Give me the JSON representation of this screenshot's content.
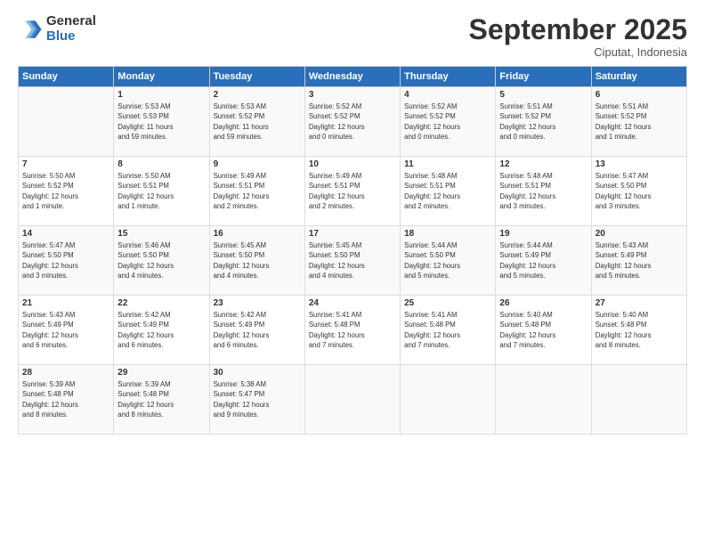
{
  "logo": {
    "general": "General",
    "blue": "Blue"
  },
  "title": "September 2025",
  "subtitle": "Ciputat, Indonesia",
  "headers": [
    "Sunday",
    "Monday",
    "Tuesday",
    "Wednesday",
    "Thursday",
    "Friday",
    "Saturday"
  ],
  "weeks": [
    [
      {
        "num": "",
        "info": ""
      },
      {
        "num": "1",
        "info": "Sunrise: 5:53 AM\nSunset: 5:53 PM\nDaylight: 11 hours\nand 59 minutes."
      },
      {
        "num": "2",
        "info": "Sunrise: 5:53 AM\nSunset: 5:52 PM\nDaylight: 11 hours\nand 59 minutes."
      },
      {
        "num": "3",
        "info": "Sunrise: 5:52 AM\nSunset: 5:52 PM\nDaylight: 12 hours\nand 0 minutes."
      },
      {
        "num": "4",
        "info": "Sunrise: 5:52 AM\nSunset: 5:52 PM\nDaylight: 12 hours\nand 0 minutes."
      },
      {
        "num": "5",
        "info": "Sunrise: 5:51 AM\nSunset: 5:52 PM\nDaylight: 12 hours\nand 0 minutes."
      },
      {
        "num": "6",
        "info": "Sunrise: 5:51 AM\nSunset: 5:52 PM\nDaylight: 12 hours\nand 1 minute."
      }
    ],
    [
      {
        "num": "7",
        "info": "Sunrise: 5:50 AM\nSunset: 5:52 PM\nDaylight: 12 hours\nand 1 minute."
      },
      {
        "num": "8",
        "info": "Sunrise: 5:50 AM\nSunset: 5:51 PM\nDaylight: 12 hours\nand 1 minute."
      },
      {
        "num": "9",
        "info": "Sunrise: 5:49 AM\nSunset: 5:51 PM\nDaylight: 12 hours\nand 2 minutes."
      },
      {
        "num": "10",
        "info": "Sunrise: 5:49 AM\nSunset: 5:51 PM\nDaylight: 12 hours\nand 2 minutes."
      },
      {
        "num": "11",
        "info": "Sunrise: 5:48 AM\nSunset: 5:51 PM\nDaylight: 12 hours\nand 2 minutes."
      },
      {
        "num": "12",
        "info": "Sunrise: 5:48 AM\nSunset: 5:51 PM\nDaylight: 12 hours\nand 3 minutes."
      },
      {
        "num": "13",
        "info": "Sunrise: 5:47 AM\nSunset: 5:50 PM\nDaylight: 12 hours\nand 3 minutes."
      }
    ],
    [
      {
        "num": "14",
        "info": "Sunrise: 5:47 AM\nSunset: 5:50 PM\nDaylight: 12 hours\nand 3 minutes."
      },
      {
        "num": "15",
        "info": "Sunrise: 5:46 AM\nSunset: 5:50 PM\nDaylight: 12 hours\nand 4 minutes."
      },
      {
        "num": "16",
        "info": "Sunrise: 5:45 AM\nSunset: 5:50 PM\nDaylight: 12 hours\nand 4 minutes."
      },
      {
        "num": "17",
        "info": "Sunrise: 5:45 AM\nSunset: 5:50 PM\nDaylight: 12 hours\nand 4 minutes."
      },
      {
        "num": "18",
        "info": "Sunrise: 5:44 AM\nSunset: 5:50 PM\nDaylight: 12 hours\nand 5 minutes."
      },
      {
        "num": "19",
        "info": "Sunrise: 5:44 AM\nSunset: 5:49 PM\nDaylight: 12 hours\nand 5 minutes."
      },
      {
        "num": "20",
        "info": "Sunrise: 5:43 AM\nSunset: 5:49 PM\nDaylight: 12 hours\nand 5 minutes."
      }
    ],
    [
      {
        "num": "21",
        "info": "Sunrise: 5:43 AM\nSunset: 5:49 PM\nDaylight: 12 hours\nand 6 minutes."
      },
      {
        "num": "22",
        "info": "Sunrise: 5:42 AM\nSunset: 5:49 PM\nDaylight: 12 hours\nand 6 minutes."
      },
      {
        "num": "23",
        "info": "Sunrise: 5:42 AM\nSunset: 5:49 PM\nDaylight: 12 hours\nand 6 minutes."
      },
      {
        "num": "24",
        "info": "Sunrise: 5:41 AM\nSunset: 5:48 PM\nDaylight: 12 hours\nand 7 minutes."
      },
      {
        "num": "25",
        "info": "Sunrise: 5:41 AM\nSunset: 5:48 PM\nDaylight: 12 hours\nand 7 minutes."
      },
      {
        "num": "26",
        "info": "Sunrise: 5:40 AM\nSunset: 5:48 PM\nDaylight: 12 hours\nand 7 minutes."
      },
      {
        "num": "27",
        "info": "Sunrise: 5:40 AM\nSunset: 5:48 PM\nDaylight: 12 hours\nand 8 minutes."
      }
    ],
    [
      {
        "num": "28",
        "info": "Sunrise: 5:39 AM\nSunset: 5:48 PM\nDaylight: 12 hours\nand 8 minutes."
      },
      {
        "num": "29",
        "info": "Sunrise: 5:39 AM\nSunset: 5:48 PM\nDaylight: 12 hours\nand 8 minutes."
      },
      {
        "num": "30",
        "info": "Sunrise: 5:38 AM\nSunset: 5:47 PM\nDaylight: 12 hours\nand 9 minutes."
      },
      {
        "num": "",
        "info": ""
      },
      {
        "num": "",
        "info": ""
      },
      {
        "num": "",
        "info": ""
      },
      {
        "num": "",
        "info": ""
      }
    ]
  ]
}
